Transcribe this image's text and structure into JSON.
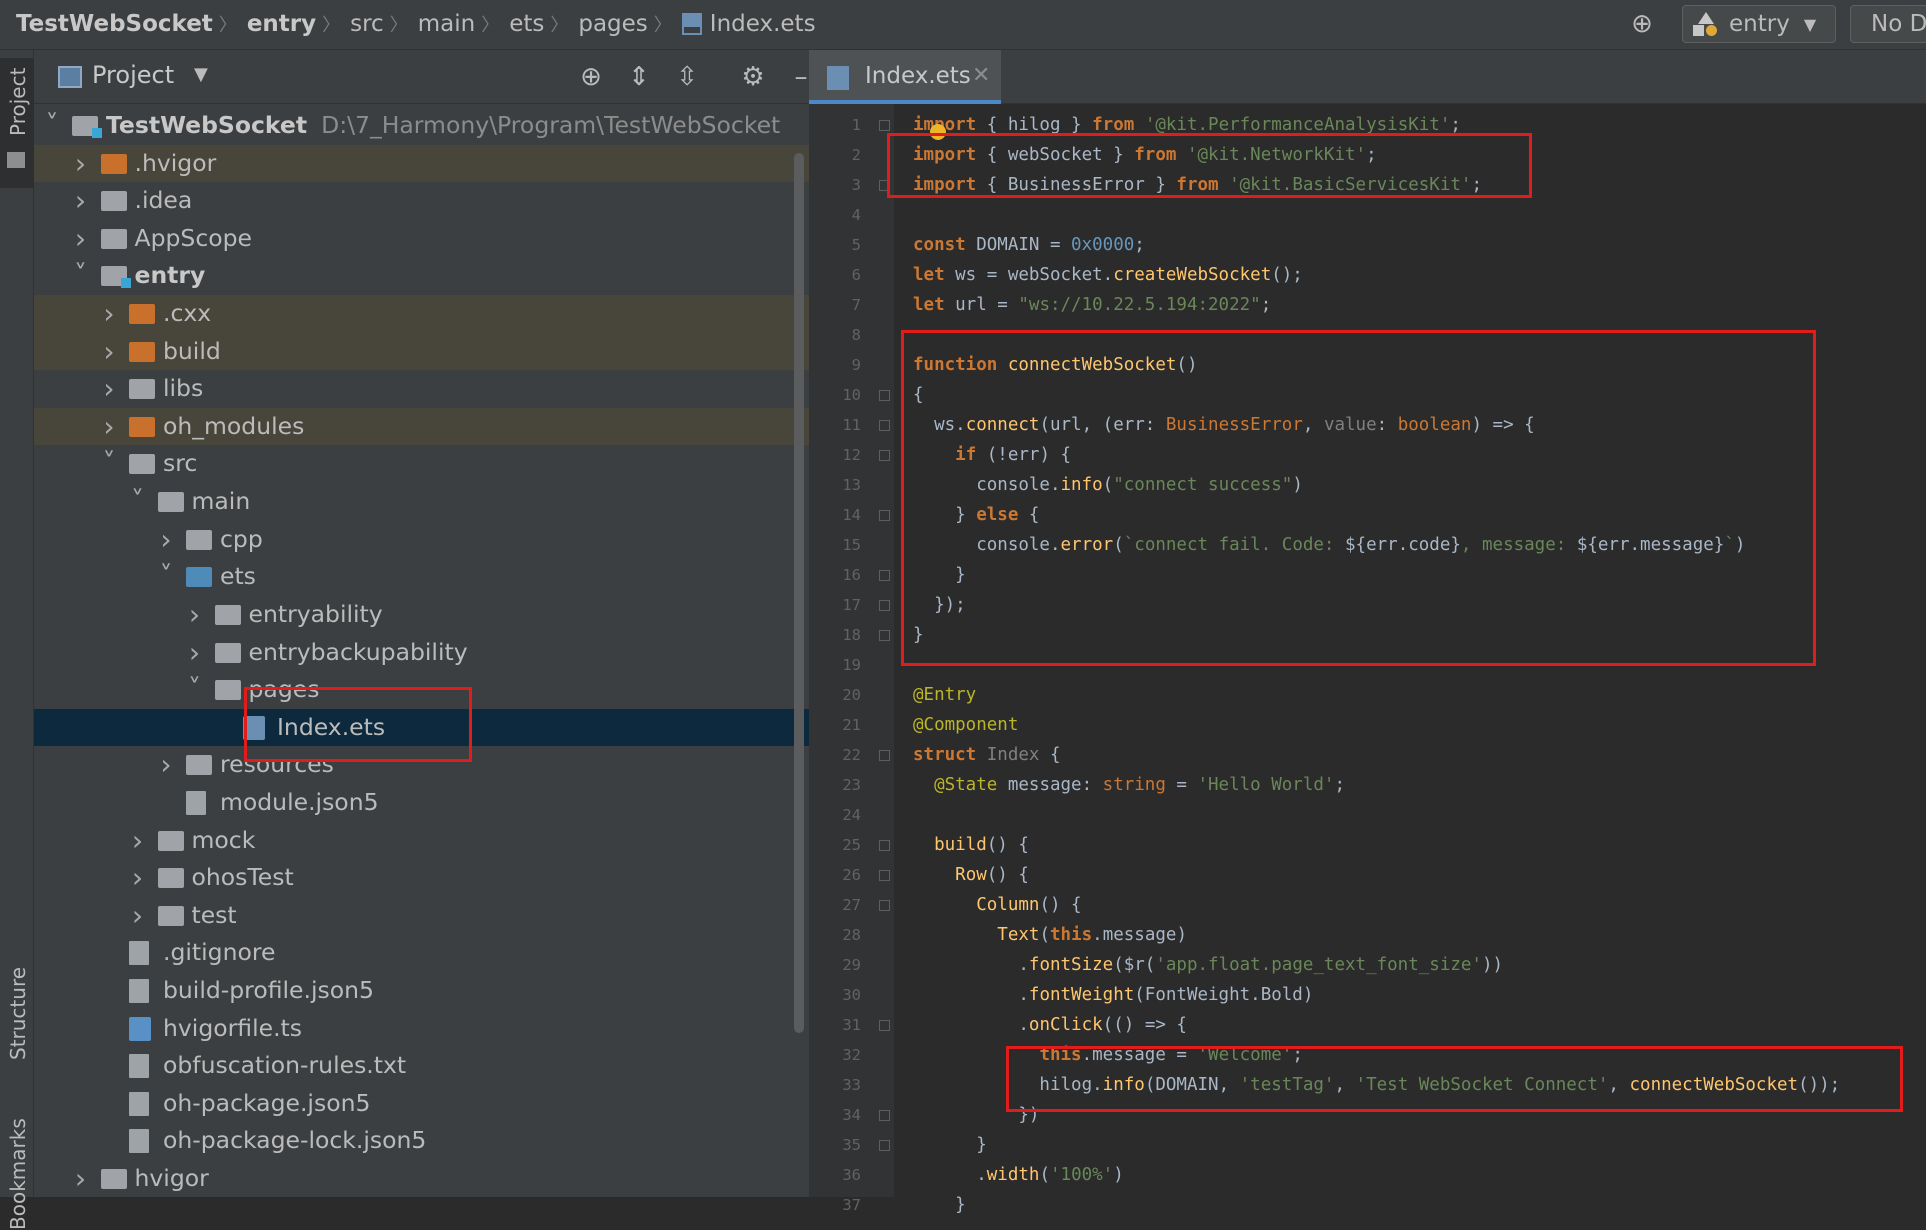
{
  "breadcrumb": [
    {
      "label": "TestWebSocket",
      "bold": true
    },
    {
      "label": "entry",
      "bold": true
    },
    {
      "label": "src",
      "bold": false
    },
    {
      "label": "main",
      "bold": false
    },
    {
      "label": "ets",
      "bold": false
    },
    {
      "label": "pages",
      "bold": false
    },
    {
      "label": "Index.ets",
      "bold": false,
      "file": true
    }
  ],
  "toolbar": {
    "run_config": "entry",
    "device": "No D"
  },
  "side_tabs": {
    "project": "Project",
    "structure": "Structure",
    "bookmarks": "Bookmarks"
  },
  "project_panel": {
    "title": "Project",
    "tree": [
      {
        "label": "TestWebSocket",
        "path": "D:\\7_Harmony\\Program\\TestWebSocket",
        "depth": 0,
        "expanded": true,
        "icon": "folder-module",
        "bold": true
      },
      {
        "label": ".hvigor",
        "depth": 1,
        "expanded": false,
        "icon": "folder-orange",
        "dim": true
      },
      {
        "label": ".idea",
        "depth": 1,
        "expanded": false,
        "icon": "folder-gray"
      },
      {
        "label": "AppScope",
        "depth": 1,
        "expanded": false,
        "icon": "folder-gray"
      },
      {
        "label": "entry",
        "depth": 1,
        "expanded": true,
        "icon": "folder-module",
        "bold": true
      },
      {
        "label": ".cxx",
        "depth": 2,
        "expanded": false,
        "icon": "folder-orange",
        "dim": true
      },
      {
        "label": "build",
        "depth": 2,
        "expanded": false,
        "icon": "folder-orange",
        "dim": true
      },
      {
        "label": "libs",
        "depth": 2,
        "expanded": false,
        "icon": "folder-gray"
      },
      {
        "label": "oh_modules",
        "depth": 2,
        "expanded": false,
        "icon": "folder-orange",
        "dim": true
      },
      {
        "label": "src",
        "depth": 2,
        "expanded": true,
        "icon": "folder-gray"
      },
      {
        "label": "main",
        "depth": 3,
        "expanded": true,
        "icon": "folder-gray"
      },
      {
        "label": "cpp",
        "depth": 4,
        "expanded": false,
        "icon": "folder-gray"
      },
      {
        "label": "ets",
        "depth": 4,
        "expanded": true,
        "icon": "folder-blue"
      },
      {
        "label": "entryability",
        "depth": 5,
        "expanded": false,
        "icon": "folder-gray"
      },
      {
        "label": "entrybackupability",
        "depth": 5,
        "expanded": false,
        "icon": "folder-gray"
      },
      {
        "label": "pages",
        "depth": 5,
        "expanded": true,
        "icon": "folder-gray"
      },
      {
        "label": "Index.ets",
        "depth": 6,
        "icon": "file-ets",
        "selected": true
      },
      {
        "label": "resources",
        "depth": 4,
        "expanded": false,
        "icon": "folder-gray"
      },
      {
        "label": "module.json5",
        "depth": 4,
        "icon": "file-json"
      },
      {
        "label": "mock",
        "depth": 3,
        "expanded": false,
        "icon": "folder-gray"
      },
      {
        "label": "ohosTest",
        "depth": 3,
        "expanded": false,
        "icon": "folder-gray"
      },
      {
        "label": "test",
        "depth": 3,
        "expanded": false,
        "icon": "folder-gray"
      },
      {
        "label": ".gitignore",
        "depth": 2,
        "icon": "file-text"
      },
      {
        "label": "build-profile.json5",
        "depth": 2,
        "icon": "file-json"
      },
      {
        "label": "hvigorfile.ts",
        "depth": 2,
        "icon": "file-ts"
      },
      {
        "label": "obfuscation-rules.txt",
        "depth": 2,
        "icon": "file-text"
      },
      {
        "label": "oh-package.json5",
        "depth": 2,
        "icon": "file-json"
      },
      {
        "label": "oh-package-lock.json5",
        "depth": 2,
        "icon": "file-json"
      },
      {
        "label": "hvigor",
        "depth": 1,
        "expanded": false,
        "icon": "folder-gray"
      }
    ]
  },
  "editor": {
    "tab_label": "Index.ets",
    "lines": [
      [
        [
          "kw",
          "import"
        ],
        [
          "t",
          " { hilog } "
        ],
        [
          "kw",
          "from"
        ],
        [
          "t",
          " "
        ],
        [
          "str",
          "'@kit.PerformanceAnalysisKit'"
        ],
        [
          "t",
          ";"
        ]
      ],
      [
        [
          "kw",
          "import"
        ],
        [
          "t",
          " { webSocket } "
        ],
        [
          "kw",
          "from"
        ],
        [
          "t",
          " "
        ],
        [
          "str",
          "'@kit.NetworkKit'"
        ],
        [
          "t",
          ";"
        ]
      ],
      [
        [
          "kw",
          "import"
        ],
        [
          "t",
          " { BusinessError } "
        ],
        [
          "kw",
          "from"
        ],
        [
          "t",
          " "
        ],
        [
          "str",
          "'@kit.BasicServicesKit'"
        ],
        [
          "t",
          ";"
        ]
      ],
      [],
      [
        [
          "kw",
          "const"
        ],
        [
          "t",
          " DOMAIN = "
        ],
        [
          "num",
          "0x0000"
        ],
        [
          "t",
          ";"
        ]
      ],
      [
        [
          "kw",
          "let"
        ],
        [
          "t",
          " ws = webSocket."
        ],
        [
          "fn",
          "createWebSocket"
        ],
        [
          "t",
          "();"
        ]
      ],
      [
        [
          "kw",
          "let"
        ],
        [
          "t",
          " url = "
        ],
        [
          "str",
          "\"ws://10.22.5.194:2022\""
        ],
        [
          "t",
          ";"
        ]
      ],
      [],
      [
        [
          "kw",
          "function"
        ],
        [
          "t",
          " "
        ],
        [
          "fn",
          "connectWebSocket"
        ],
        [
          "t",
          "()"
        ]
      ],
      [
        [
          "t",
          "{"
        ]
      ],
      [
        [
          "t",
          "  ws."
        ],
        [
          "fn",
          "connect"
        ],
        [
          "t",
          "(url, (err: "
        ],
        [
          "ty",
          "BusinessError"
        ],
        [
          "t",
          ", "
        ],
        [
          "par",
          "value"
        ],
        [
          "t",
          ": "
        ],
        [
          "ty",
          "boolean"
        ],
        [
          "t",
          ") => {"
        ]
      ],
      [
        [
          "t",
          "    "
        ],
        [
          "kw",
          "if"
        ],
        [
          "t",
          " (!err) {"
        ]
      ],
      [
        [
          "t",
          "      console."
        ],
        [
          "fn",
          "info"
        ],
        [
          "t",
          "("
        ],
        [
          "str",
          "\"connect success\""
        ],
        [
          "t",
          ")"
        ]
      ],
      [
        [
          "t",
          "    } "
        ],
        [
          "kw",
          "else"
        ],
        [
          "t",
          " {"
        ]
      ],
      [
        [
          "t",
          "      console."
        ],
        [
          "fn",
          "error"
        ],
        [
          "t",
          "("
        ],
        [
          "str",
          "`connect fail. Code: "
        ],
        [
          "t",
          "${err.code}"
        ],
        [
          "str",
          ", message: "
        ],
        [
          "t",
          "${err.message}"
        ],
        [
          "str",
          "`"
        ],
        [
          "t",
          ")"
        ]
      ],
      [
        [
          "t",
          "    }"
        ]
      ],
      [
        [
          "t",
          "  });"
        ]
      ],
      [
        [
          "t",
          "}"
        ]
      ],
      [],
      [
        [
          "ann",
          "@Entry"
        ]
      ],
      [
        [
          "ann",
          "@Component"
        ]
      ],
      [
        [
          "kw",
          "struct"
        ],
        [
          "t",
          " "
        ],
        [
          "par",
          "Index"
        ],
        [
          "t",
          " {"
        ]
      ],
      [
        [
          "t",
          "  "
        ],
        [
          "ann",
          "@State"
        ],
        [
          "t",
          " message: "
        ],
        [
          "ty",
          "string"
        ],
        [
          "t",
          " = "
        ],
        [
          "str",
          "'Hello World'"
        ],
        [
          "t",
          ";"
        ]
      ],
      [],
      [
        [
          "t",
          "  "
        ],
        [
          "fn",
          "build"
        ],
        [
          "t",
          "() {"
        ]
      ],
      [
        [
          "t",
          "    "
        ],
        [
          "fn",
          "Row"
        ],
        [
          "t",
          "() {"
        ]
      ],
      [
        [
          "t",
          "      "
        ],
        [
          "fn",
          "Column"
        ],
        [
          "t",
          "() {"
        ]
      ],
      [
        [
          "t",
          "        "
        ],
        [
          "fn",
          "Text"
        ],
        [
          "t",
          "("
        ],
        [
          "kw",
          "this"
        ],
        [
          "t",
          ".message)"
        ]
      ],
      [
        [
          "t",
          "          ."
        ],
        [
          "fn",
          "fontSize"
        ],
        [
          "t",
          "($r("
        ],
        [
          "str",
          "'app.float.page_text_font_size'"
        ],
        [
          "t",
          "))"
        ]
      ],
      [
        [
          "t",
          "          ."
        ],
        [
          "fn",
          "fontWeight"
        ],
        [
          "t",
          "(FontWeight.Bold)"
        ]
      ],
      [
        [
          "t",
          "          ."
        ],
        [
          "fn",
          "onClick"
        ],
        [
          "t",
          "(() => {"
        ]
      ],
      [
        [
          "t",
          "            "
        ],
        [
          "kw",
          "this"
        ],
        [
          "t",
          ".message = "
        ],
        [
          "str",
          "'Welcome'"
        ],
        [
          "t",
          ";"
        ]
      ],
      [
        [
          "t",
          "            hilog."
        ],
        [
          "fn",
          "info"
        ],
        [
          "t",
          "(DOMAIN, "
        ],
        [
          "str",
          "'testTag'"
        ],
        [
          "t",
          ", "
        ],
        [
          "str",
          "'Test WebSocket Connect'"
        ],
        [
          "t",
          ", "
        ],
        [
          "fn",
          "connectWebSocket"
        ],
        [
          "t",
          "());"
        ]
      ],
      [
        [
          "t",
          "          })"
        ]
      ],
      [
        [
          "t",
          "      }"
        ]
      ],
      [
        [
          "t",
          "      ."
        ],
        [
          "fn",
          "width"
        ],
        [
          "t",
          "("
        ],
        [
          "str",
          "'100%'"
        ],
        [
          "t",
          ")"
        ]
      ],
      [
        [
          "t",
          "    }"
        ]
      ]
    ]
  },
  "colors": {
    "highlight_box": "#e21b1b",
    "selection": "#0d293e",
    "tab_underline": "#4a88c7"
  }
}
